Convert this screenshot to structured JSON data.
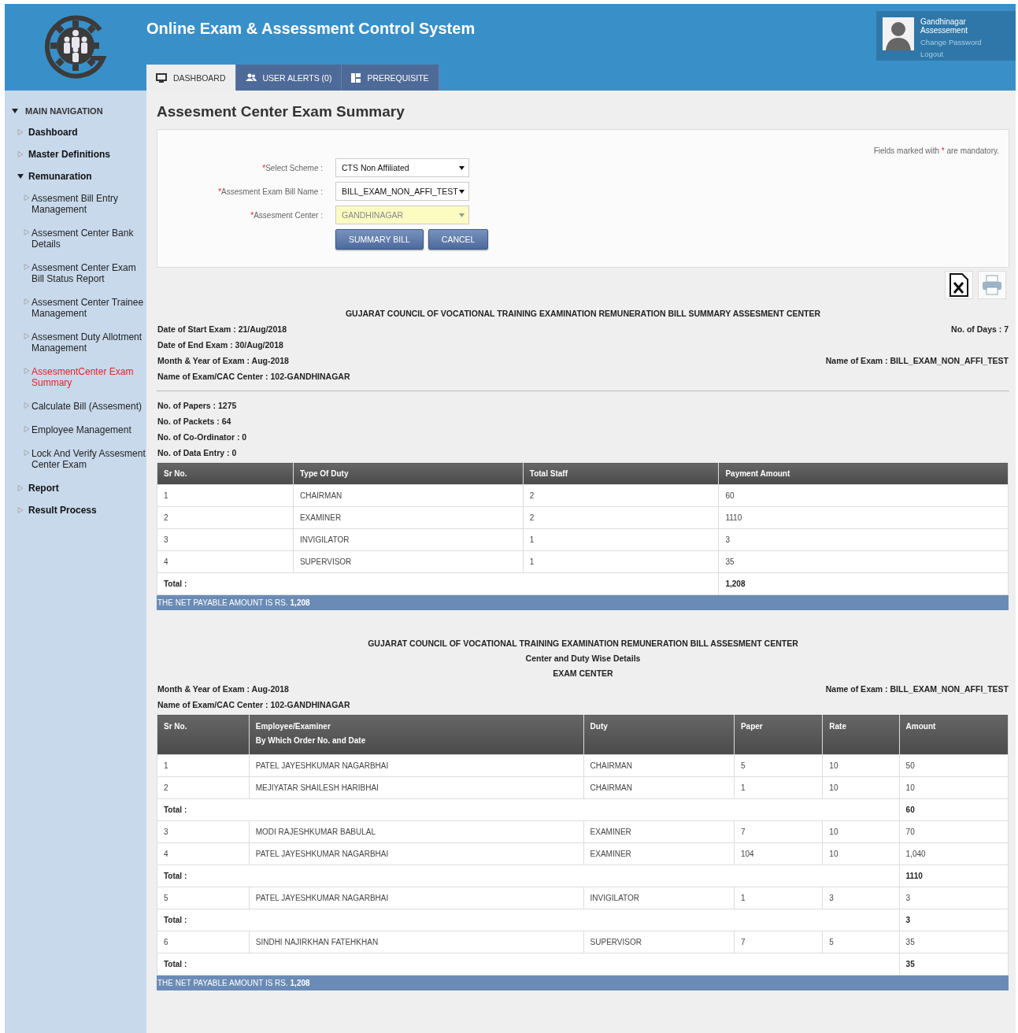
{
  "header": {
    "title": "Online Exam & Assessment Control System",
    "user": {
      "name": "Gandhinagar Assessement",
      "links": [
        "Change Password",
        "Logout"
      ]
    },
    "tabs": [
      {
        "label": "DASHBOARD",
        "selected": true
      },
      {
        "label": "USER ALERTS (0)",
        "selected": false
      },
      {
        "label": "PREREQUISITE",
        "selected": false
      }
    ]
  },
  "sidebar": {
    "heading": "MAIN NAVIGATION",
    "expanded": true,
    "items": [
      {
        "label": "Dashboard",
        "expanded": false,
        "selected": false
      },
      {
        "label": "Master Definitions",
        "expanded": false,
        "selected": false
      },
      {
        "label": "Remunaration",
        "expanded": true,
        "selected": false,
        "children": [
          {
            "label": "Assesment Bill Entry Management",
            "selected": false
          },
          {
            "label": "Assesment Center Bank Details",
            "selected": false
          },
          {
            "label": "Assesment Center Exam Bill Status Report",
            "selected": false
          },
          {
            "label": "Assesment Center Trainee Management",
            "selected": false
          },
          {
            "label": "Assesment Duty Allotment Management",
            "selected": false
          },
          {
            "label": "AssesmentCenter Exam Summary",
            "selected": true
          },
          {
            "label": "Calculate Bill (Assesment)",
            "selected": false
          },
          {
            "label": "Employee Management",
            "selected": false
          },
          {
            "label": "Lock And Verify Assesment Center Exam",
            "selected": false
          }
        ]
      },
      {
        "label": "Report",
        "expanded": false,
        "selected": false
      },
      {
        "label": "Result Process",
        "expanded": false,
        "selected": false
      }
    ]
  },
  "page_title": "Assesment Center Exam Summary",
  "form": {
    "note_start": "Fields marked with",
    "required_mark": "*",
    "note_end": "are mandatory.",
    "fields": [
      {
        "label": "Select Scheme :",
        "value": "CTS Non Affiliated",
        "required": true,
        "disabled": false
      },
      {
        "label": "Assesment Exam Bill Name :",
        "value": "BILL_EXAM_NON_AFFI_TEST",
        "required": true,
        "disabled": false
      },
      {
        "label": "Assesment Center :",
        "value": "GANDHINAGAR",
        "required": true,
        "disabled": true
      }
    ],
    "buttons": [
      "SUMMARY BILL",
      "CANCEL"
    ]
  },
  "summary": {
    "title": "GUJARAT COUNCIL OF VOCATIONAL TRAINING EXAMINATION REMUNERATION BILL SUMMARY ASSESMENT CENTER",
    "details": [
      {
        "left": "Date of Start Exam : 21/Aug/2018",
        "right": "No. of Days : 7"
      },
      {
        "left": "Date of End Exam : 30/Aug/2018"
      },
      {
        "left": "Month & Year of Exam : Aug-2018",
        "right": "Name of Exam : BILL_EXAM_NON_AFFI_TEST"
      },
      {
        "left": "Name of Exam/CAC Center : 102-GANDHINAGAR"
      }
    ],
    "counts": [
      "No. of Papers : 1275",
      "No. of Packets : 64",
      "No. of Co-Ordinator : 0",
      "No. of Data Entry : 0"
    ],
    "columns": [
      "Sr No.",
      "Type Of Duty",
      "Total Staff",
      "Payment Amount"
    ],
    "rows": [
      [
        "1",
        "CHAIRMAN",
        "2",
        "60"
      ],
      [
        "2",
        "EXAMINER",
        "2",
        "1110"
      ],
      [
        "3",
        "INVIGILATOR",
        "1",
        "3"
      ],
      [
        "4",
        "SUPERVISOR",
        "1",
        "35"
      ]
    ],
    "total_label": "Total :",
    "total_value": "1,208",
    "net_payable": "THE NET PAYABLE AMOUNT IS RS. **1,208**"
  },
  "detail_report": {
    "titles": [
      "GUJARAT COUNCIL OF VOCATIONAL TRAINING EXAMINATION REMUNERATION BILL ASSESMENT CENTER",
      "Center and Duty Wise Details",
      "EXAM CENTER"
    ],
    "details": [
      {
        "left": "Month & Year of Exam : Aug-2018",
        "right": "Name of Exam : BILL_EXAM_NON_AFFI_TEST"
      },
      {
        "left": "Name of Exam/CAC Center : 102-GANDHINAGAR"
      }
    ],
    "columns": [
      {
        "label": "Sr No."
      },
      {
        "label": "Employee/Examiner",
        "sublabel": "By Which Order No. and Date"
      },
      {
        "label": "Duty"
      },
      {
        "label": "Paper"
      },
      {
        "label": "Rate"
      },
      {
        "label": "Amount"
      }
    ],
    "rows": [
      {
        "kind": "entry",
        "cells": [
          "1",
          "PATEL JAYESHKUMAR NAGARBHAI",
          "CHAIRMAN",
          "5",
          "10",
          "50"
        ]
      },
      {
        "kind": "entry",
        "cells": [
          "2",
          "MEJIYATAR SHAILESH HARIBHAI",
          "CHAIRMAN",
          "1",
          "10",
          "10"
        ]
      },
      {
        "kind": "total",
        "label": "Total :",
        "value": "60"
      },
      {
        "kind": "entry",
        "cells": [
          "3",
          "MODI RAJESHKUMAR BABULAL",
          "EXAMINER",
          "7",
          "10",
          "70"
        ]
      },
      {
        "kind": "entry",
        "cells": [
          "4",
          "PATEL JAYESHKUMAR NAGARBHAI",
          "EXAMINER",
          "104",
          "10",
          "1,040"
        ]
      },
      {
        "kind": "total",
        "label": "Total :",
        "value": "1110"
      },
      {
        "kind": "entry",
        "cells": [
          "5",
          "PATEL JAYESHKUMAR NAGARBHAI",
          "INVIGILATOR",
          "1",
          "3",
          "3"
        ]
      },
      {
        "kind": "total",
        "label": "Total :",
        "value": "3"
      },
      {
        "kind": "entry",
        "cells": [
          "6",
          "SINDHI NAJIRKHAN FATEHKHAN",
          "SUPERVISOR",
          "7",
          "5",
          "35"
        ]
      },
      {
        "kind": "total",
        "label": "Total :",
        "value": "35"
      }
    ],
    "net_payable": "THE NET PAYABLE AMOUNT IS RS. **1,208**"
  }
}
